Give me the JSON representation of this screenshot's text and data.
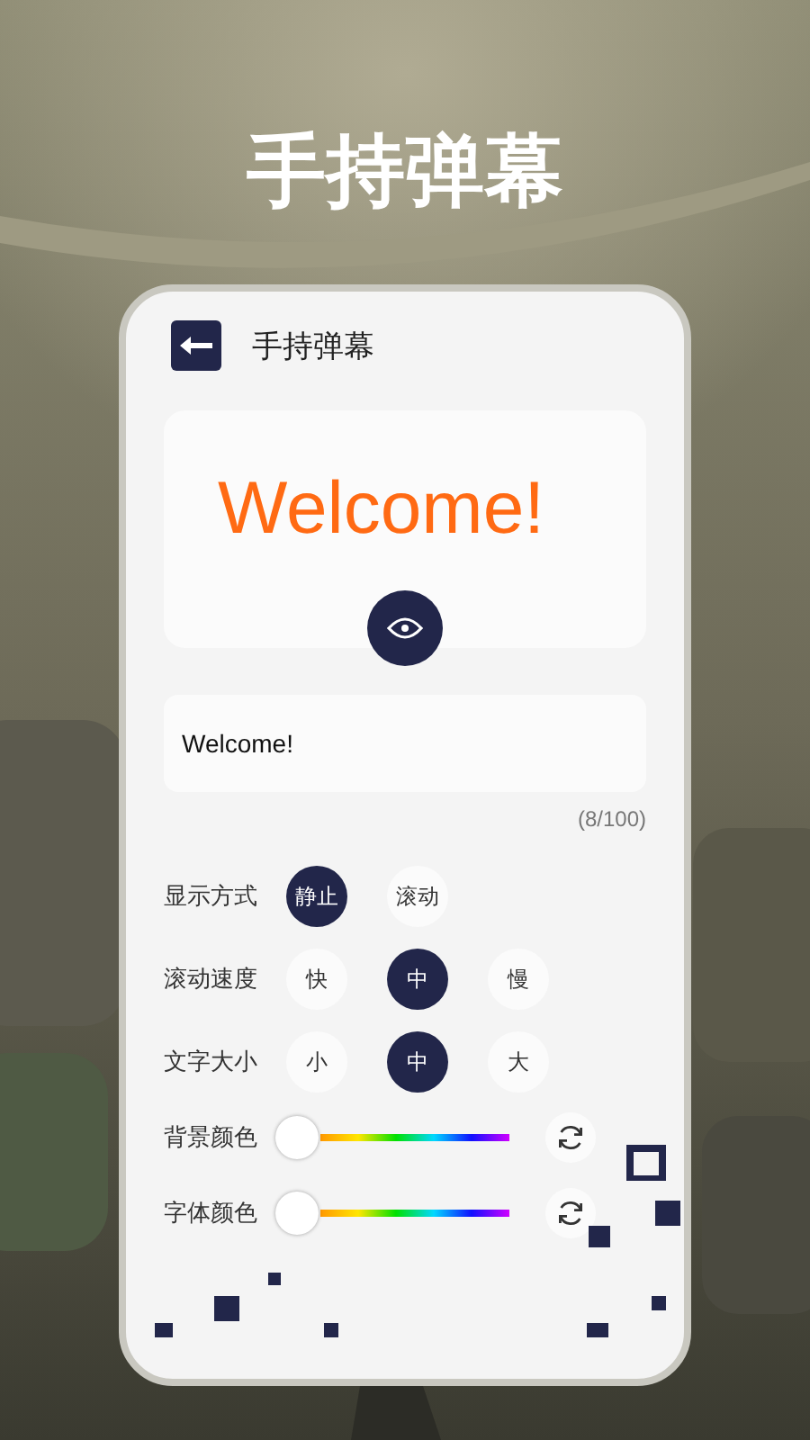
{
  "headline": "手持弹幕",
  "screen": {
    "title": "手持弹幕",
    "preview": {
      "text": "Welcome!"
    },
    "input": {
      "value": "Welcome!",
      "counter": "(8/100)"
    },
    "option_rows": [
      {
        "label": "显示方式",
        "options": [
          {
            "label": "静止",
            "selected": true
          },
          {
            "label": "滚动",
            "selected": false
          }
        ]
      },
      {
        "label": "滚动速度",
        "options": [
          {
            "label": "快",
            "selected": false
          },
          {
            "label": "中",
            "selected": true
          },
          {
            "label": "慢",
            "selected": false
          }
        ]
      },
      {
        "label": "文字大小",
        "options": [
          {
            "label": "小",
            "selected": false
          },
          {
            "label": "中",
            "selected": true
          },
          {
            "label": "大",
            "selected": false
          }
        ]
      }
    ],
    "color_rows": [
      {
        "label": "背景颜色",
        "level": 0
      },
      {
        "label": "字体颜色",
        "level": 0
      }
    ]
  }
}
